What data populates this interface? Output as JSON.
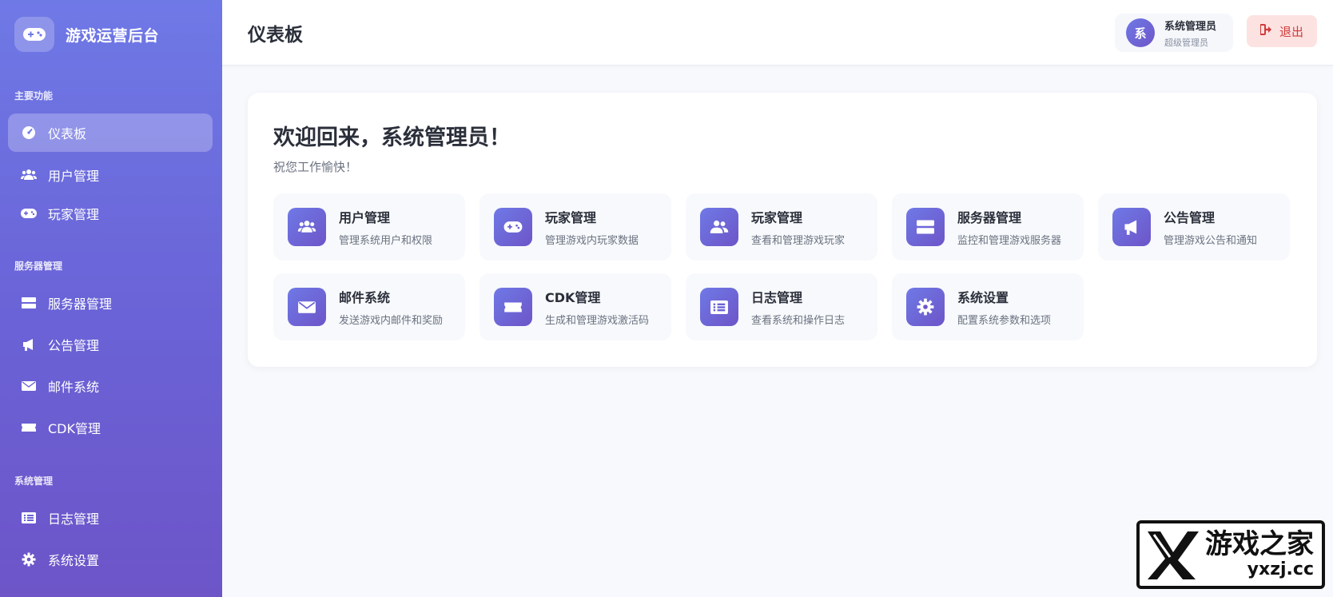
{
  "app": {
    "title": "游戏运营后台"
  },
  "sidebar": {
    "sections": [
      {
        "label": "主要功能"
      },
      {
        "label": "服务器管理"
      },
      {
        "label": "系统管理"
      }
    ],
    "items": [
      {
        "label": "仪表板",
        "icon": "dashboard-icon",
        "active": true
      },
      {
        "label": "用户管理",
        "icon": "users-icon"
      },
      {
        "label": "玩家管理",
        "icon": "gamepad-icon"
      },
      {
        "label": "服务器管理",
        "icon": "server-icon"
      },
      {
        "label": "公告管理",
        "icon": "megaphone-icon"
      },
      {
        "label": "邮件系统",
        "icon": "envelope-icon"
      },
      {
        "label": "CDK管理",
        "icon": "ticket-icon"
      },
      {
        "label": "日志管理",
        "icon": "list-icon"
      },
      {
        "label": "系统设置",
        "icon": "gear-icon"
      }
    ]
  },
  "header": {
    "title": "仪表板",
    "user": {
      "avatar": "系",
      "name": "系统管理员",
      "role": "超级管理员"
    },
    "logout_label": "退出"
  },
  "welcome": {
    "title": "欢迎回来，系统管理员！",
    "subtitle": "祝您工作愉快！"
  },
  "quick_links": [
    {
      "title": "用户管理",
      "desc": "管理系统用户和权限",
      "icon": "users-icon"
    },
    {
      "title": "玩家管理",
      "desc": "管理游戏内玩家数据",
      "icon": "gamepad-icon"
    },
    {
      "title": "玩家管理",
      "desc": "查看和管理游戏玩家",
      "icon": "user-group-icon"
    },
    {
      "title": "服务器管理",
      "desc": "监控和管理游戏服务器",
      "icon": "server-icon"
    },
    {
      "title": "公告管理",
      "desc": "管理游戏公告和通知",
      "icon": "megaphone-icon"
    },
    {
      "title": "邮件系统",
      "desc": "发送游戏内邮件和奖励",
      "icon": "envelope-icon"
    },
    {
      "title": "CDK管理",
      "desc": "生成和管理游戏激活码",
      "icon": "ticket-icon"
    },
    {
      "title": "日志管理",
      "desc": "查看系统和操作日志",
      "icon": "list-icon"
    },
    {
      "title": "系统设置",
      "desc": "配置系统参数和选项",
      "icon": "gear-icon"
    }
  ],
  "watermark": {
    "name": "游戏之家",
    "url": "yxzj.cc"
  },
  "colors": {
    "accent_start": "#6f79e6",
    "accent_end": "#6d55c8",
    "logout_bg": "#fde2e2",
    "logout_text": "#d03b3b"
  }
}
